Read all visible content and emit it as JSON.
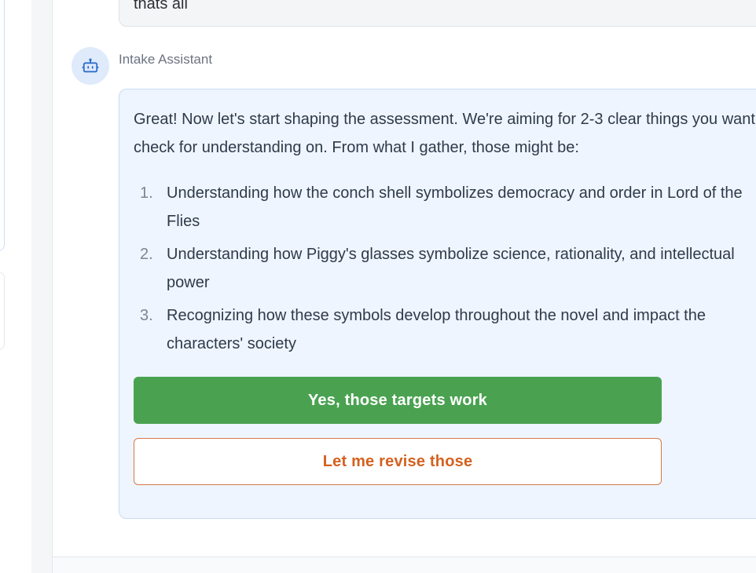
{
  "previous_message": {
    "text": "thats all"
  },
  "assistant": {
    "name": "Intake Assistant",
    "avatar_icon": "robot-icon",
    "intro": "Great! Now let's start shaping the assessment. We're aiming for 2-3 clear things you want to check for understanding on. From what I gather, those might be:",
    "targets": [
      {
        "number": "1.",
        "text": "Understanding how the conch shell symbolizes democracy and order in Lord of the Flies"
      },
      {
        "number": "2.",
        "text": "Understanding how Piggy's glasses symbolize science, rationality, and intellectual power"
      },
      {
        "number": "3.",
        "text": "Recognizing how these symbols develop throughout the novel and impact the characters' society"
      }
    ],
    "confirm_label": "Yes, those targets work",
    "revise_label": "Let me revise those"
  },
  "colors": {
    "assistant_bubble_bg": "#eef5fe",
    "confirm_button": "#4aa251",
    "revise_button_text": "#d4611f",
    "avatar_bg": "#dfeafb",
    "icon_color": "#2f6fcb"
  }
}
